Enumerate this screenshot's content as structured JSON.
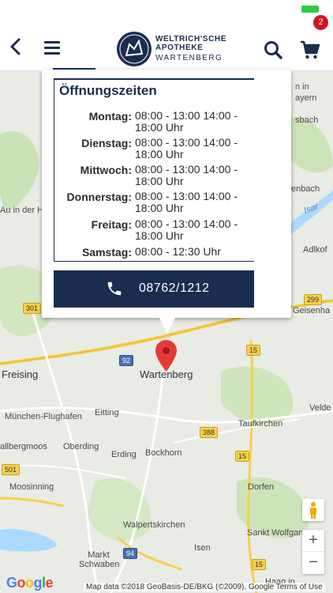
{
  "header": {
    "logo_line1": "WELTRICH'SCHE",
    "logo_line2": "APOTHEKE",
    "logo_line3": "WARTENBERG",
    "cart_count": "2",
    "back_icon": "chevron-left-icon",
    "menu_icon": "hamburger-icon",
    "search_icon": "search-icon",
    "cart_icon": "cart-icon"
  },
  "info_window": {
    "title": "Öffnungszeiten",
    "hours": [
      {
        "day": "Montag:",
        "time": "08:00 - 13:00 14:00 - 18:00 Uhr"
      },
      {
        "day": "Dienstag:",
        "time": "08:00 - 13:00 14:00 - 18:00 Uhr"
      },
      {
        "day": "Mittwoch:",
        "time": "08:00 - 13:00 14:00 - 18:00 Uhr"
      },
      {
        "day": "Donnerstag:",
        "time": "08:00 - 13:00 14:00 - 18:00 Uhr"
      },
      {
        "day": "Freitag:",
        "time": "08:00 - 13:00 14:00 - 18:00 Uhr"
      },
      {
        "day": "Samstag:",
        "time": "08:00 - 12:30 Uhr"
      }
    ],
    "phone": "08762/1212",
    "phone_icon": "phone-icon"
  },
  "map": {
    "places": {
      "wartenberg": "Wartenberg",
      "freising": "Freising",
      "muenchen_flughafen": "München-Flughafen",
      "eitting": "Eitting",
      "oberding": "Oberding",
      "erding": "Erding",
      "bockhorn": "Bockhorn",
      "taufkirchen": "Taufkirchen",
      "moosinning": "Moosinning",
      "walpertskirchen": "Walpertskirchen",
      "dorfen": "Dorfen",
      "sankt_wolfgang": "Sankt Wolfgang",
      "isen": "Isen",
      "markt_schwaben": "Markt Schwaben",
      "au_hallertau": "Au in der Hallertau",
      "adlkofen": "Adlkof",
      "geisenhausen": "Geisenha",
      "velden": "Velde",
      "hallbergmoos": "allbergmoos",
      "haag": "Haag in",
      "isar": "Isar",
      "bayern_fragment": "ayern",
      "sbach_fragment": "sbach",
      "in_fragment": "n in",
      "enbach_fragment": "enbach"
    },
    "roads": [
      "301",
      "92",
      "15",
      "299",
      "388",
      "15",
      "94",
      "15",
      "501",
      "15"
    ],
    "google_logo": "Google",
    "attribution": "Map data ©2018 GeoBasis-DE/BKG (©2009), Google   Terms of Use",
    "zoom_in_label": "+",
    "zoom_out_label": "−",
    "pegman_icon": "pegman-icon",
    "marker_icon": "map-marker-icon"
  },
  "colors": {
    "brand": "#1a2d4f",
    "badge": "#d0161e",
    "marker": "#e53935",
    "status_battery": "#2ecc40"
  }
}
